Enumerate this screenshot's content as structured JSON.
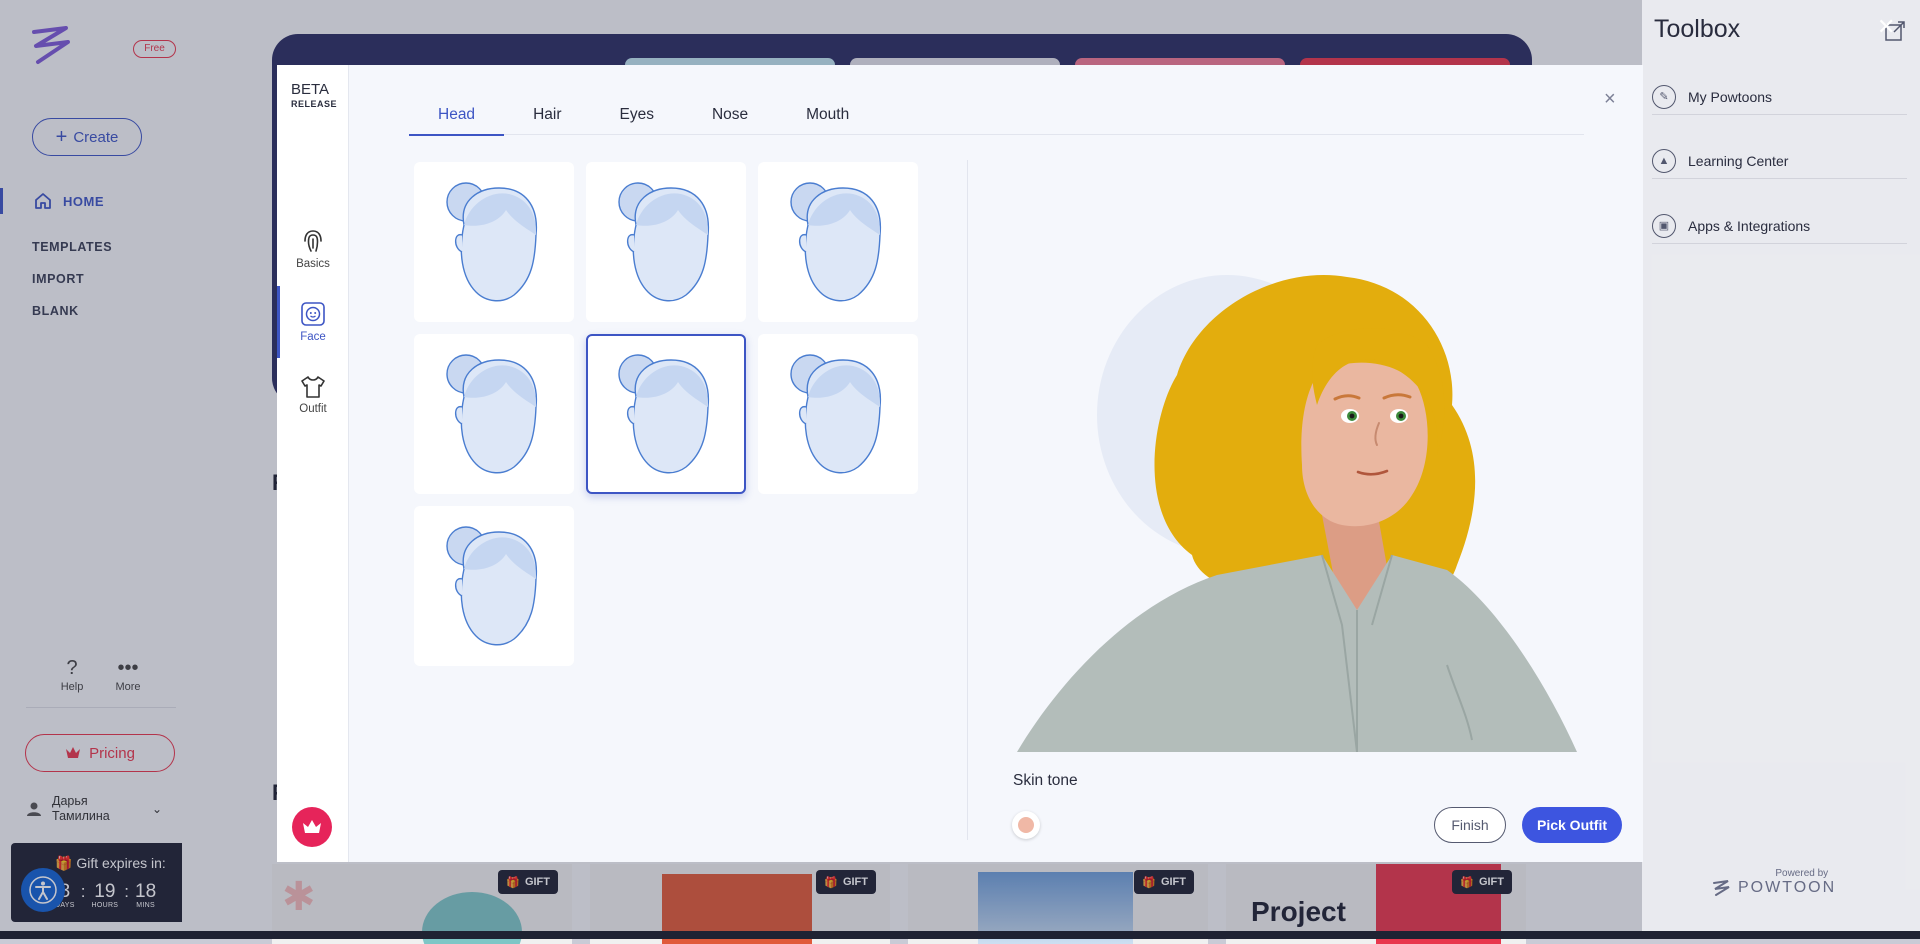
{
  "sidebar": {
    "free_badge": "Free",
    "create_label": "Create",
    "nav": {
      "home": "HOME",
      "templates": "TEMPLATES",
      "import": "IMPORT",
      "blank": "BLANK"
    },
    "help_label": "Help",
    "more_label": "More",
    "pricing_label": "Pricing",
    "user_name_line1": "Дарья",
    "user_name_line2": "Тамилина",
    "gift_timer": {
      "title": "Gift expires in:",
      "days": "3",
      "days_unit": "DAYS",
      "hours": "19",
      "hours_unit": "HOURS",
      "mins": "18",
      "mins_unit": "MINS"
    }
  },
  "background": {
    "template_cards": [
      {
        "gift_label": "GIFT"
      },
      {
        "gift_label": "GIFT"
      },
      {
        "gift_label": "GIFT"
      },
      {
        "gift_label": "GIFT",
        "title": "Project"
      }
    ]
  },
  "toolbox": {
    "title": "Toolbox",
    "items": [
      {
        "label": "My Powtoons",
        "icon": "powtoon-icon"
      },
      {
        "label": "Learning Center",
        "icon": "graduation-cap-icon"
      },
      {
        "label": "Apps & Integrations",
        "icon": "apps-icon"
      }
    ],
    "powered_by": "Powered by",
    "brand": "POWTOON"
  },
  "modal": {
    "beta_line1": "BETA",
    "beta_line2": "RELEASE",
    "rail": [
      {
        "label": "Basics",
        "icon": "fingerprint-icon",
        "active": false
      },
      {
        "label": "Face",
        "icon": "face-icon",
        "active": true
      },
      {
        "label": "Outfit",
        "icon": "tshirt-icon",
        "active": false
      }
    ],
    "tabs": [
      "Head",
      "Hair",
      "Eyes",
      "Nose",
      "Mouth"
    ],
    "active_tab": "Head",
    "head_options_count": 7,
    "selected_head_index": 4,
    "skin_tone_label": "Skin tone",
    "skin_tone_color": "#f0b8a6",
    "finish_label": "Finish",
    "pick_outfit_label": "Pick Outfit",
    "colors": {
      "accent": "#3d55c4",
      "button": "#3d55e0",
      "crown": "#e6245a",
      "hair": "#e3ad0d",
      "skin": "#eab7a0",
      "shirt": "#b3bdba"
    }
  }
}
